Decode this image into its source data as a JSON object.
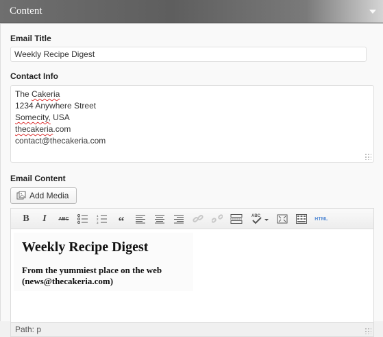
{
  "panel": {
    "title": "Content"
  },
  "fields": {
    "email_title": {
      "label": "Email Title",
      "value": "Weekly Recipe Digest"
    },
    "contact_info": {
      "label": "Contact Info",
      "lines": [
        "The Cakeria",
        "1234 Anywhere Street",
        "Somecity, USA",
        "thecakeria.com",
        "contact@thecakeria.com"
      ]
    },
    "email_content": {
      "label": "Email Content"
    }
  },
  "media": {
    "add_label": "Add Media"
  },
  "toolbar": {
    "bold": "B",
    "italic": "I",
    "strikethrough": "ABC",
    "blockquote": "“",
    "html": "HTML",
    "icons": [
      "bold-icon",
      "italic-icon",
      "strikethrough-icon",
      "bullet-list-icon",
      "numbered-list-icon",
      "blockquote-icon",
      "align-left-icon",
      "align-center-icon",
      "align-right-icon",
      "insert-link-icon",
      "unlink-icon",
      "read-more-icon",
      "spellcheck-icon",
      "fullscreen-icon",
      "kitchen-sink-icon",
      "html-icon"
    ]
  },
  "editor": {
    "heading": "Weekly Recipe Digest",
    "line1": "From the yummiest place on the web",
    "line2": "(news@thecakeria.com)",
    "path": "Path: p"
  }
}
